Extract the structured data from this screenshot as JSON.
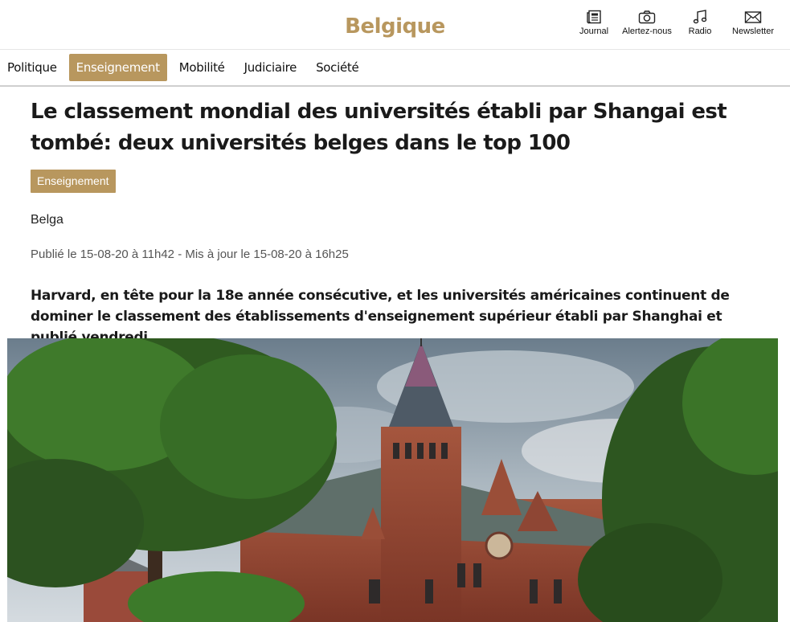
{
  "header": {
    "brand": "Belgique",
    "tools": [
      {
        "label": "Journal",
        "icon": "newspaper-icon"
      },
      {
        "label": "Alertez-nous",
        "icon": "camera-icon"
      },
      {
        "label": "Radio",
        "icon": "music-note-icon"
      },
      {
        "label": "Newsletter",
        "icon": "envelope-icon"
      }
    ]
  },
  "nav": {
    "items": [
      "Politique",
      "Enseignement",
      "Mobilité",
      "Judiciaire",
      "Société"
    ],
    "active": "Enseignement"
  },
  "article": {
    "headline": "Le classement mondial des universités établi par Shangai est tombé: deux universités belges dans le top 100",
    "tag": "Enseignement",
    "author": "Belga",
    "dates": "Publié le 15-08-20 à 11h42 - Mis à jour le 15-08-20 à 16h25",
    "lead": "Harvard, en tête pour la 18e année consécutive, et les universités américaines continuent de dominer le classement des établissements d'enseignement supérieur établi par Shanghai et publié vendredi."
  },
  "colors": {
    "accent": "#b8975e"
  }
}
